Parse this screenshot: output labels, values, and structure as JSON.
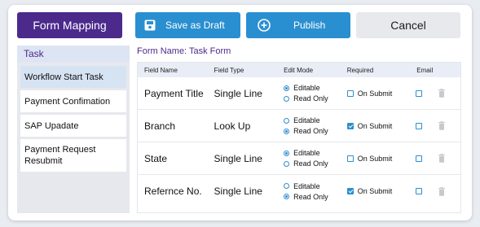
{
  "toolbar": {
    "form_mapping_label": "Form Mapping",
    "save_draft_label": "Save as Draft",
    "publish_label": "Publish",
    "cancel_label": "Cancel"
  },
  "sidebar": {
    "header": "Task",
    "items": [
      {
        "label": "Workflow Start Task",
        "active": true
      },
      {
        "label": "Payment Confimation",
        "active": false
      },
      {
        "label": "SAP Upadate",
        "active": false
      },
      {
        "label": "Payment Request Resubmit",
        "active": false
      }
    ]
  },
  "form": {
    "name_label": "Form Name: Task Form"
  },
  "table": {
    "headers": {
      "field_name": "Field Name",
      "field_type": "Field Type",
      "edit_mode": "Edit Mode",
      "required": "Required",
      "email": "Email"
    },
    "edit_options": [
      "Editable",
      "Read Only"
    ],
    "required_option": "On Submit",
    "rows": [
      {
        "name": "Payment Title",
        "type": "Single Line",
        "mode": "Editable",
        "required": false,
        "email": false
      },
      {
        "name": "Branch",
        "type": "Look Up",
        "mode": "Read Only",
        "required": true,
        "email": false
      },
      {
        "name": "State",
        "type": "Single Line",
        "mode": "Editable",
        "required": false,
        "email": false
      },
      {
        "name": "Refernce No.",
        "type": "Single Line",
        "mode": "Read Only",
        "required": true,
        "email": false
      }
    ]
  },
  "colors": {
    "primary_purple": "#4b2a8c",
    "action_blue": "#2a8fd0",
    "cancel_gray": "#e7e9ed"
  }
}
